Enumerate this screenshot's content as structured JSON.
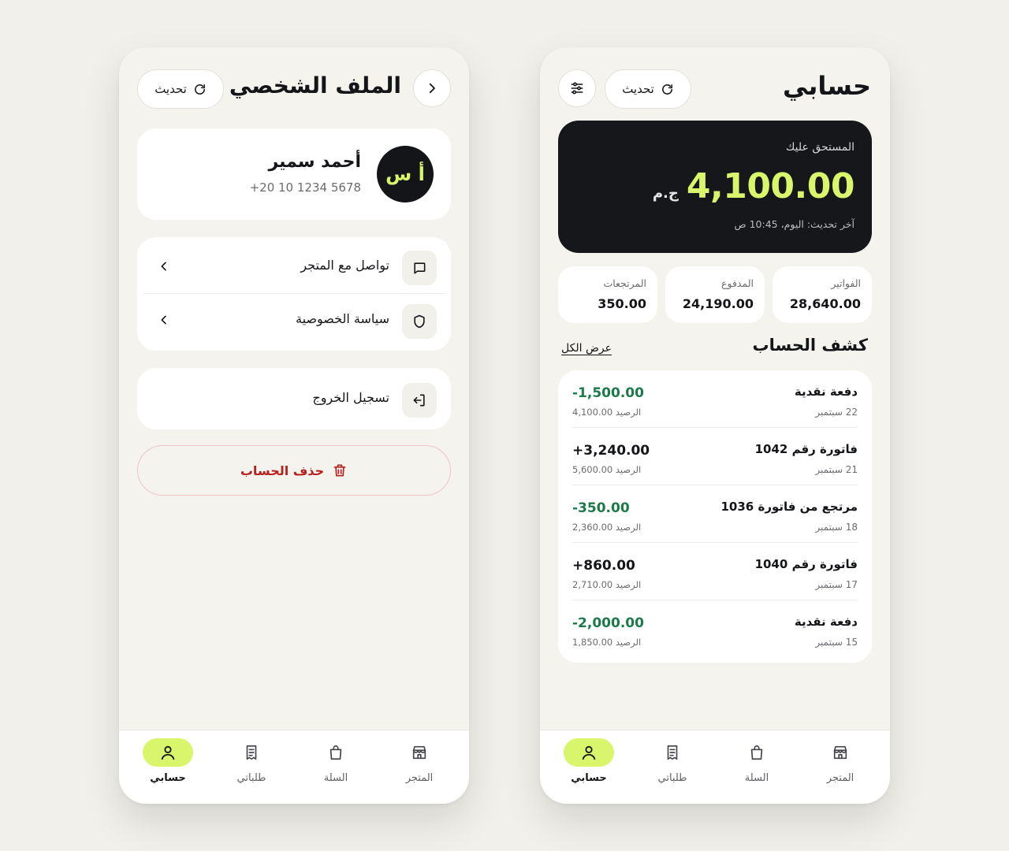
{
  "profile_screen": {
    "title": "الملف الشخصي",
    "refresh_label": "تحديث",
    "user": {
      "initials": "أ س",
      "name": "أحمد سمير",
      "phone": "+20 10 1234 5678"
    },
    "menu": [
      {
        "label": "تواصل مع المتجر",
        "icon": "chat-icon"
      },
      {
        "label": "سياسة الخصوصية",
        "icon": "shield-icon"
      }
    ],
    "logout_label": "تسجيل الخروج",
    "delete_label": "حذف الحساب"
  },
  "account_screen": {
    "title": "حسابي",
    "refresh_label": "تحديث",
    "balance": {
      "label": "المستحق عليك",
      "amount": "4,100.00",
      "currency": "ج.م",
      "updated": "آخر تحديث: اليوم، 10:45 ص"
    },
    "stats": [
      {
        "label": "الفواتير",
        "value": "28,640.00"
      },
      {
        "label": "المدفوع",
        "value": "24,190.00"
      },
      {
        "label": "المرتجعات",
        "value": "350.00"
      }
    ],
    "statement_title": "كشف الحساب",
    "view_all_label": "عرض الكل",
    "transactions": [
      {
        "title": "دفعة نقدية",
        "date": "22 سبتمبر",
        "amount": "-1,500.00",
        "balance": "الرصيد 4,100.00",
        "type": "neg"
      },
      {
        "title": "فاتورة رقم 1042",
        "date": "21 سبتمبر",
        "amount": "+3,240.00",
        "balance": "الرصيد 5,600.00",
        "type": "pos"
      },
      {
        "title": "مرتجع من فاتورة 1036",
        "date": "18 سبتمبر",
        "amount": "-350.00",
        "balance": "الرصيد 2,360.00",
        "type": "neg"
      },
      {
        "title": "فاتورة رقم 1040",
        "date": "17 سبتمبر",
        "amount": "+860.00",
        "balance": "الرصيد 2,710.00",
        "type": "pos"
      },
      {
        "title": "دفعة نقدية",
        "date": "15 سبتمبر",
        "amount": "-2,000.00",
        "balance": "الرصيد 1,850.00",
        "type": "neg"
      }
    ]
  },
  "nav": {
    "items": [
      {
        "label": "حسابي",
        "icon": "user-icon",
        "active": true
      },
      {
        "label": "طلباتي",
        "icon": "receipt-icon"
      },
      {
        "label": "السلة",
        "icon": "bag-icon"
      },
      {
        "label": "المتجر",
        "icon": "store-icon"
      }
    ]
  },
  "colors": {
    "accent": "#d9f56b",
    "dark": "#16171a",
    "negative_amount": "#1c7a4a",
    "danger": "#b4231d",
    "background": "#f1f0ea"
  }
}
